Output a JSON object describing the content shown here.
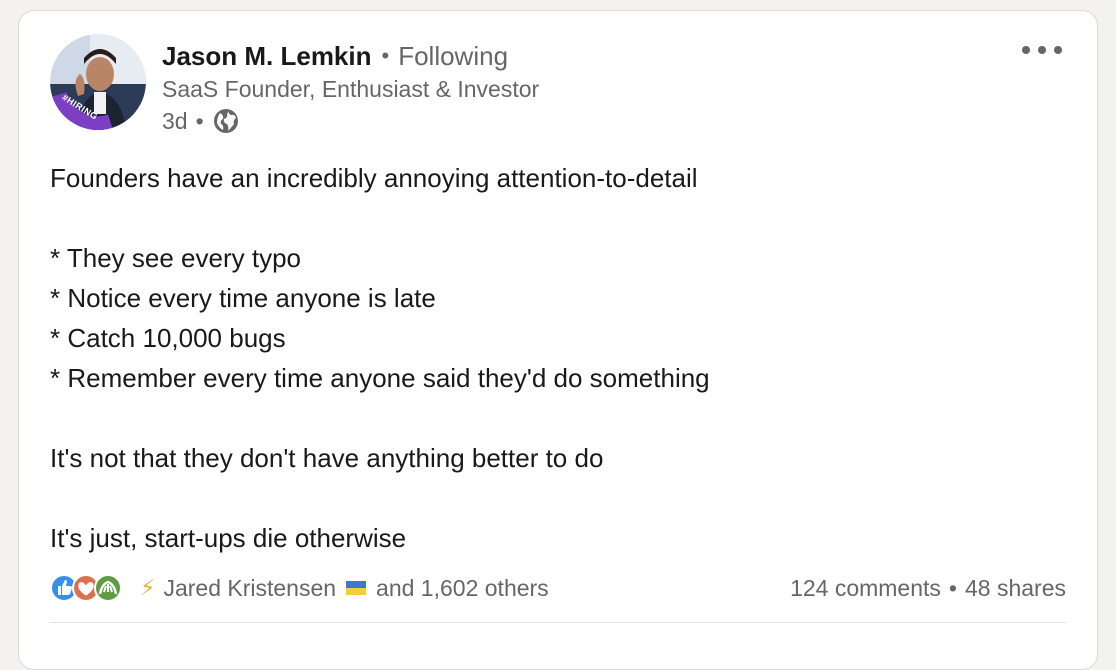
{
  "author": {
    "name": "Jason M. Lemkin",
    "following": "Following",
    "headline": "SaaS Founder, Enthusiast & Investor",
    "time": "3d",
    "avatar_badge": "#HIRING",
    "visibility_icon": "globe-icon"
  },
  "post": {
    "lines": [
      "Founders have an incredibly annoying attention-to-detail",
      "",
      "* They see every typo",
      "* Notice every time anyone is late",
      "* Catch 10,000 bugs",
      "* Remember every time anyone said they'd do something",
      "",
      "It's not that they don't have anything better to do",
      "",
      "It's just, start-ups die otherwise"
    ]
  },
  "social": {
    "reactor": "Jared Kristensen",
    "reactor_flag": "ukraine-flag-icon",
    "others": "and 1,602 others",
    "comments": "124 comments",
    "shares": "48 shares"
  },
  "colors": {
    "like": "#378fe9",
    "love": "#df704d",
    "support": "#5f9b41",
    "hiring_ring": "#7c3ec3"
  }
}
